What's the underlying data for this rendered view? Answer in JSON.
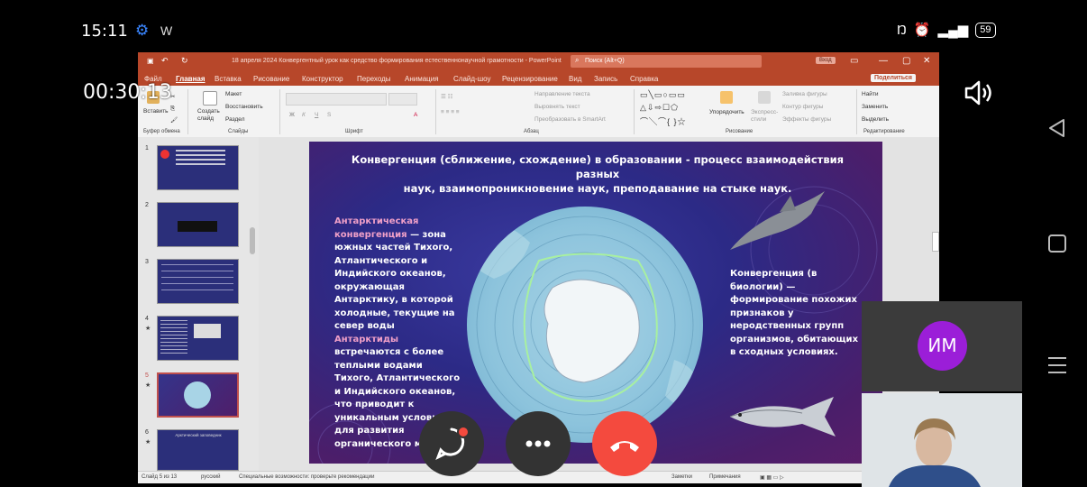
{
  "status_bar": {
    "time": "15:11",
    "app_letter": "W",
    "battery": "59"
  },
  "call": {
    "timer": "00:30:13",
    "participant_initials": "ИМ"
  },
  "powerpoint": {
    "title": "18 апреля 2024 Конвергентный урок как средство формирования естественнонаучной грамотности  -  PowerPoint",
    "search_placeholder": "Поиск (Alt+Q)",
    "sign_in": "Вход",
    "tabs": [
      "Файл",
      "Главная",
      "Вставка",
      "Рисование",
      "Конструктор",
      "Переходы",
      "Анимация",
      "Слайд-шоу",
      "Рецензирование",
      "Вид",
      "Запись",
      "Справка"
    ],
    "share": "Поделиться",
    "ribbon": {
      "paste": "Вставить",
      "clipboard_group": "Буфер обмена",
      "new_slide": "Создать слайд",
      "layout": "Макет",
      "reset": "Восстановить",
      "section": "Раздел",
      "slides_group": "Слайды",
      "font_group": "Шрифт",
      "text_direction": "Направление текста",
      "align_text": "Выровнять текст",
      "smartart": "Преобразовать в SmartArt",
      "paragraph_group": "Абзац",
      "arrange": "Упорядочить",
      "quick_styles": "Экспресс-стили",
      "shape_fill": "Заливка фигуры",
      "shape_outline": "Контур фигуры",
      "shape_effects": "Эффекты фигуры",
      "drawing_group": "Рисование",
      "find": "Найти",
      "replace": "Заменить",
      "select": "Выделить",
      "editing_group": "Редактирование"
    },
    "thumbnails": [
      {
        "num": "1",
        "star": ""
      },
      {
        "num": "2",
        "star": ""
      },
      {
        "num": "3",
        "star": ""
      },
      {
        "num": "4",
        "star": "★"
      },
      {
        "num": "5",
        "star": "★"
      },
      {
        "num": "6",
        "star": "★"
      }
    ],
    "thumb6_text": "Арктический заповедник",
    "slide": {
      "title_line1": "Конвергенция (сближение, схождение) в образовании - процесс взаимодействия разных",
      "title_line2": "наук, взаимопроникновение наук, преподавание на стыке наук.",
      "left_hl1": "Антарктическая конвергенция",
      "left_text1": " — зона южных частей Тихого, Атлантического и Индийского океанов, окружающая Антарктику, в которой холодные, текущие на север воды ",
      "left_hl2": "Антарктиды",
      "left_text2": " встречаются с более теплыми водами Тихого, Атлантического и Индийского океанов, что приводит к уникальным условиям для развития органического мира",
      "right_text": "Конвергенция (в биологии) — формирование похожих признаков у неродственных групп организмов, обитающих в сходных условиях."
    },
    "statusbar": {
      "slide_info": "Слайд 5 из 13",
      "language": "русский",
      "accessibility": "Специальные возможности: проверьте рекомендации",
      "notes": "Заметки",
      "comments": "Примечания"
    }
  },
  "colors": {
    "ppt_accent": "#b7472a",
    "hangup": "#f44a3e",
    "avatar": "#9b1ed8"
  }
}
